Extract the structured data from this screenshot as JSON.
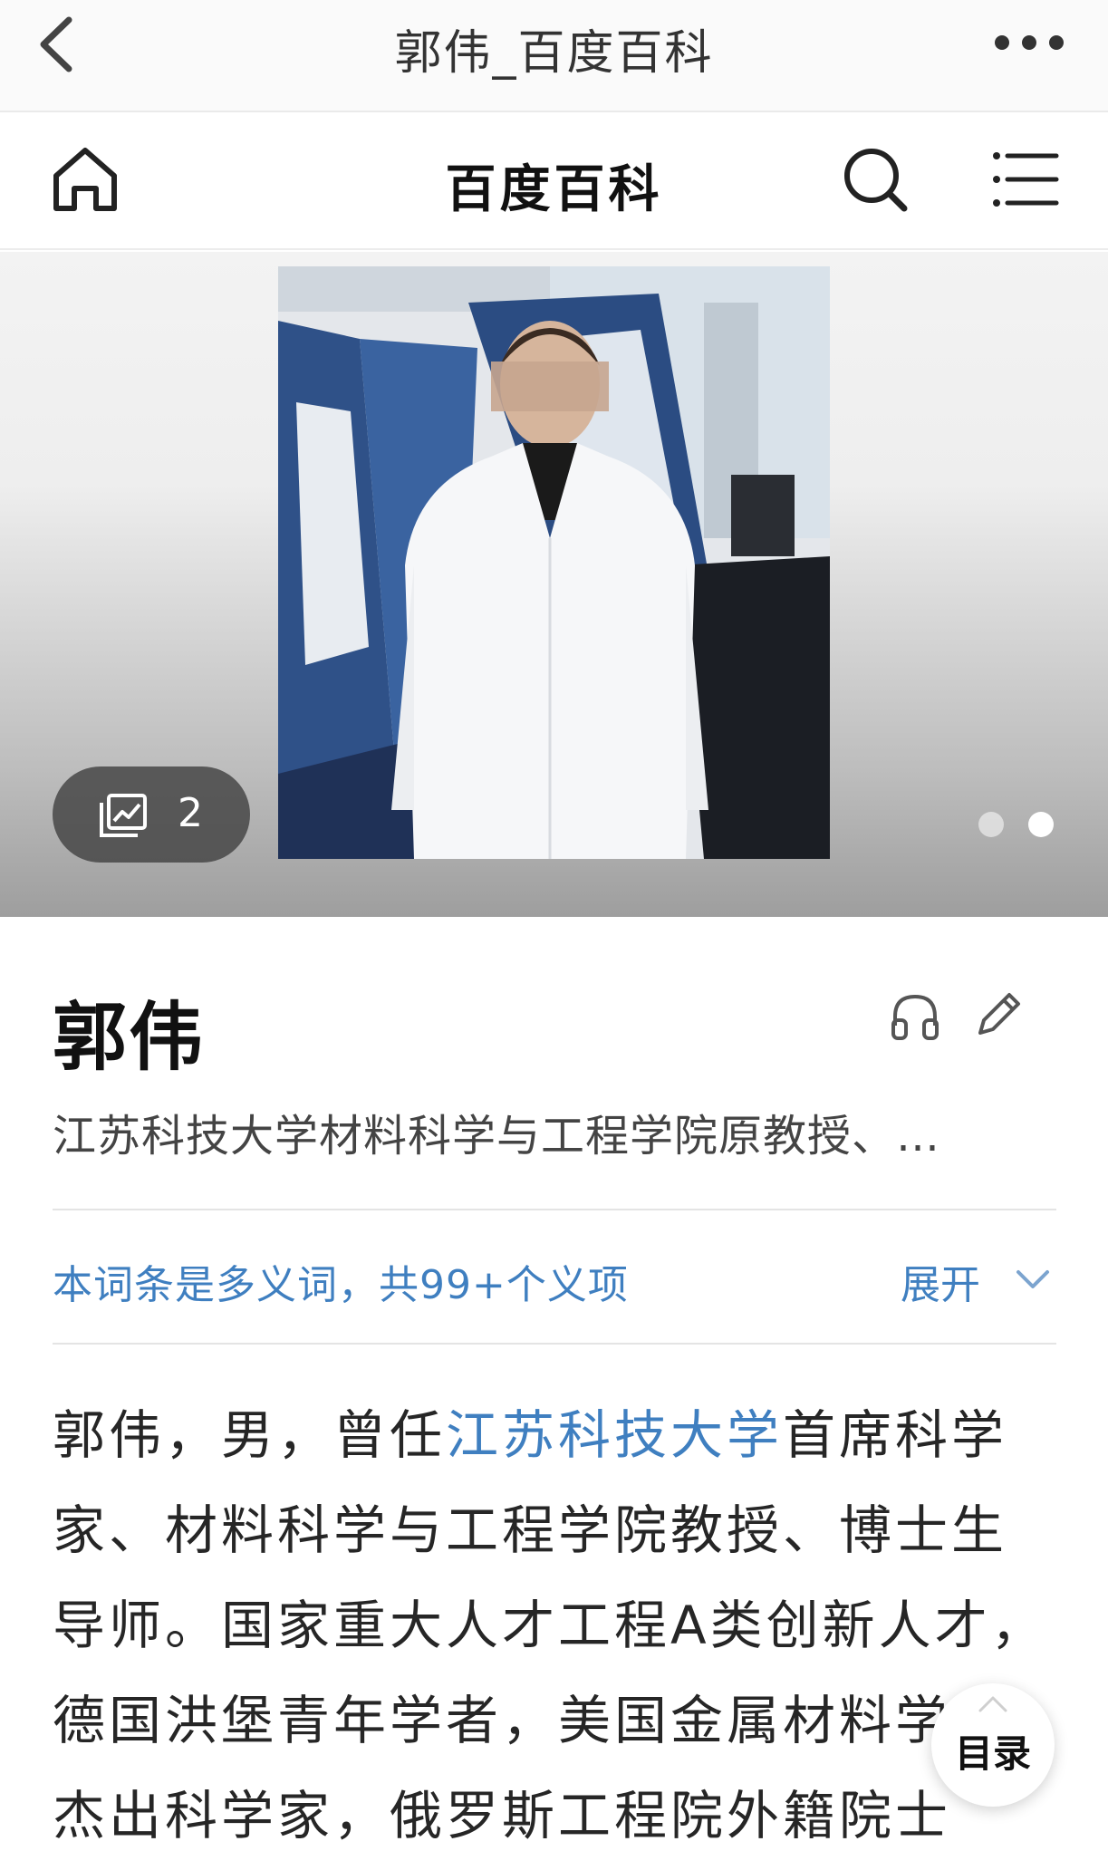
{
  "topbar": {
    "title": "郭伟_百度百科"
  },
  "navbar": {
    "brand": "百度百科"
  },
  "hero": {
    "gallery_count": "2",
    "slides": 2,
    "active_slide": 2
  },
  "entry": {
    "name": "郭伟",
    "summary": "江苏科技大学材料科学与工程学院原教授、…",
    "polysemy_note": "本词条是多义词，共99+个义项",
    "expand_label": "展开",
    "body": {
      "l1_a": "郭伟，男，曾任",
      "l1_link": "江苏科技大学",
      "l1_b": "首席科学",
      "l2": "家、材料科学与工程学院教授、博士生",
      "l3": "导师。国家重大人才工程A类创新人才，",
      "l4": "德国洪堡青年学者，美国金属材料学",
      "l5": "杰出科学家，俄罗斯工程院外籍院士"
    }
  },
  "toc": {
    "label": "目录"
  },
  "colors": {
    "link": "#3f7fc0",
    "badge": "#464646"
  }
}
